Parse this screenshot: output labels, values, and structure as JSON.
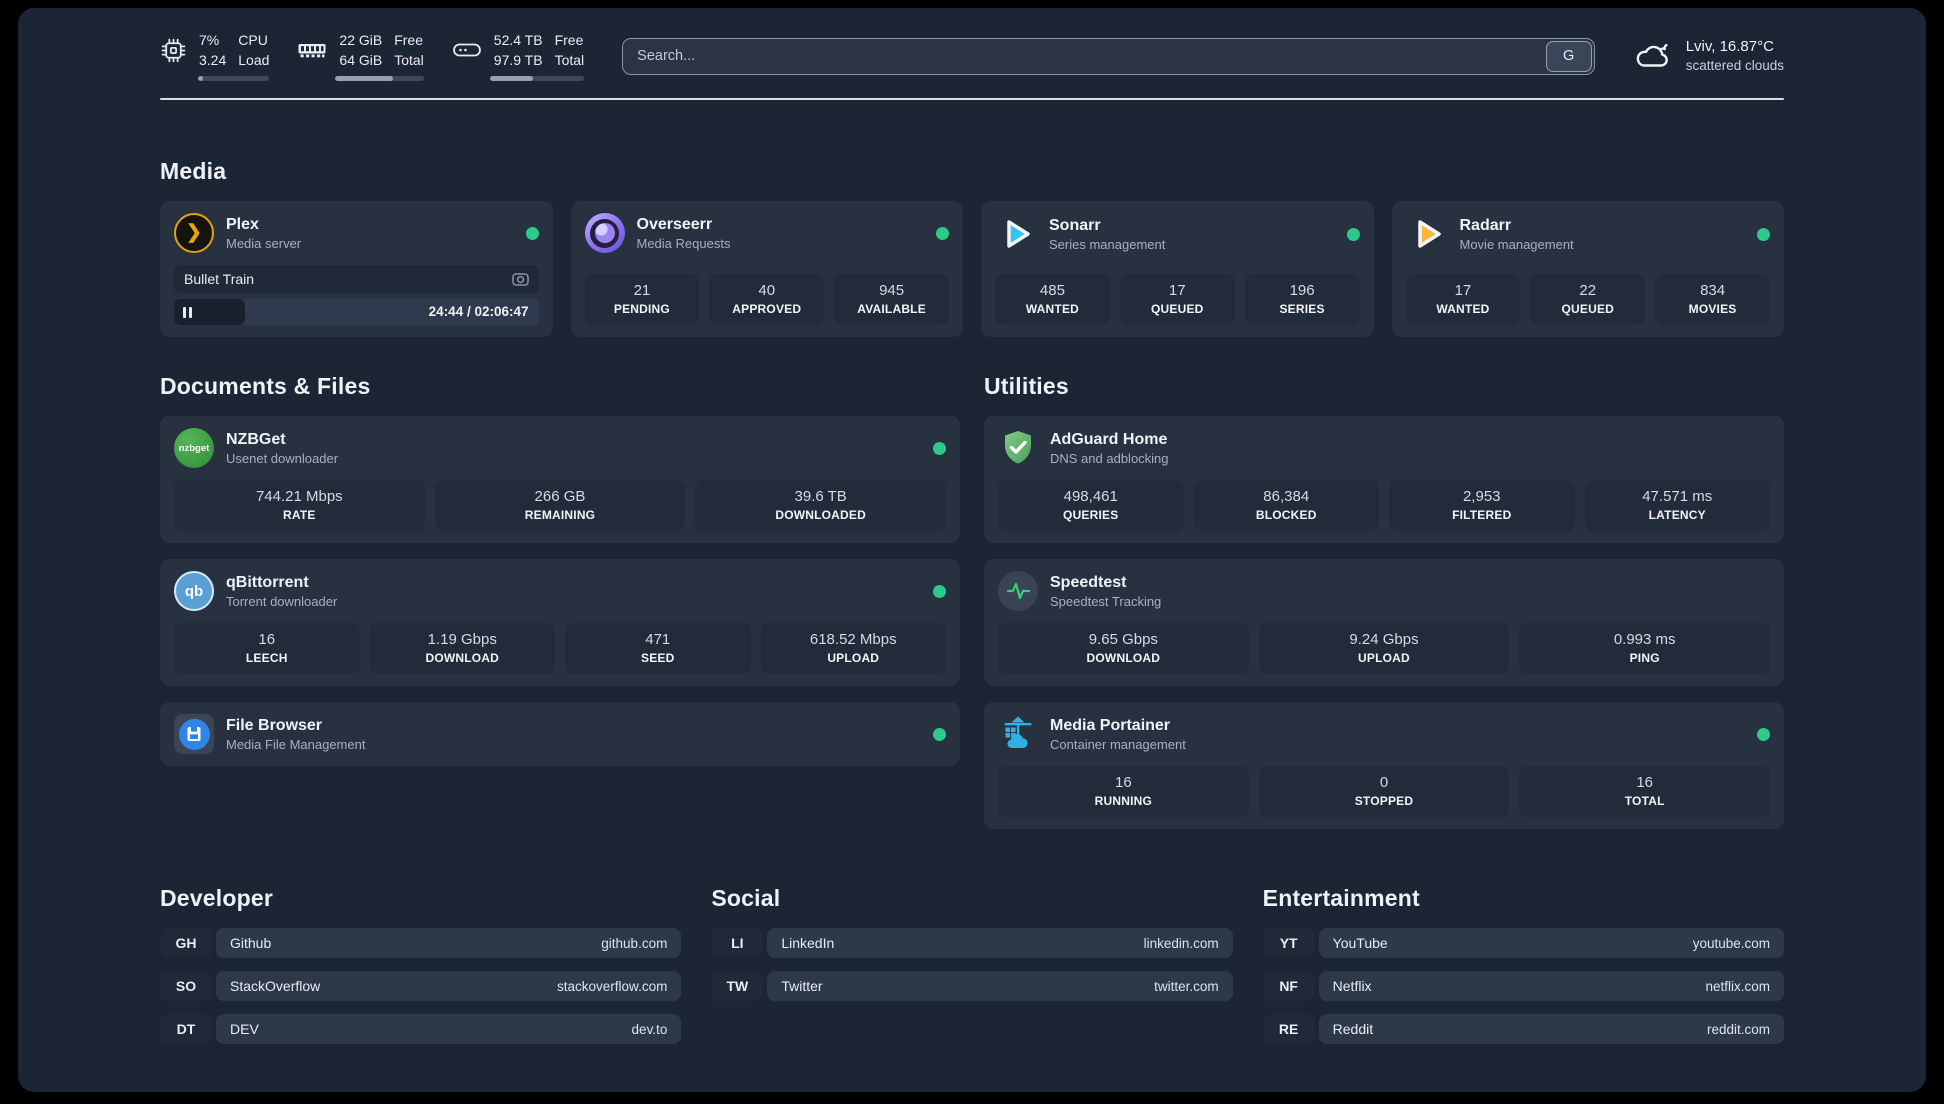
{
  "header": {
    "stats": [
      {
        "icon": "cpu-icon",
        "value_top": "7%",
        "value_bottom": "3.24",
        "label_top": "CPU",
        "label_bottom": "Load",
        "progress_pct": 7
      },
      {
        "icon": "ram-icon",
        "value_top": "22 GiB",
        "value_bottom": "64 GiB",
        "label_top": "Free",
        "label_bottom": "Total",
        "progress_pct": 65
      },
      {
        "icon": "disk-icon",
        "value_top": "52.4 TB",
        "value_bottom": "97.9 TB",
        "label_top": "Free",
        "label_bottom": "Total",
        "progress_pct": 46
      }
    ],
    "search": {
      "placeholder": "Search...",
      "button_label": "G"
    },
    "weather": {
      "location": "Lviv, 16.87°C",
      "condition": "scattered clouds"
    }
  },
  "icons": {
    "plex_glyph": "❯",
    "qbittorrent_text": "qb",
    "nzbget_text": "nzbget"
  },
  "sections": {
    "media": {
      "title": "Media",
      "cards": [
        {
          "name": "Plex",
          "subtitle": "Media server",
          "icon": "plex-icon",
          "online": true,
          "player": {
            "track_title": "Bullet Train",
            "time": "24:44 / 02:06:47",
            "progress_pct": 19.5
          }
        },
        {
          "name": "Overseerr",
          "subtitle": "Media Requests",
          "icon": "overseerr-icon",
          "online": true,
          "stats": [
            {
              "value": "21",
              "label": "PENDING"
            },
            {
              "value": "40",
              "label": "APPROVED"
            },
            {
              "value": "945",
              "label": "AVAILABLE"
            }
          ]
        },
        {
          "name": "Sonarr",
          "subtitle": "Series management",
          "icon": "sonarr-icon",
          "online": true,
          "stats": [
            {
              "value": "485",
              "label": "WANTED"
            },
            {
              "value": "17",
              "label": "QUEUED"
            },
            {
              "value": "196",
              "label": "SERIES"
            }
          ]
        },
        {
          "name": "Radarr",
          "subtitle": "Movie management",
          "icon": "radarr-icon",
          "online": true,
          "stats": [
            {
              "value": "17",
              "label": "WANTED"
            },
            {
              "value": "22",
              "label": "QUEUED"
            },
            {
              "value": "834",
              "label": "MOVIES"
            }
          ]
        }
      ]
    },
    "documents": {
      "title": "Documents & Files",
      "cards": [
        {
          "name": "NZBGet",
          "subtitle": "Usenet downloader",
          "icon": "nzbget-icon",
          "online": true,
          "stats": [
            {
              "value": "744.21 Mbps",
              "label": "RATE"
            },
            {
              "value": "266 GB",
              "label": "REMAINING"
            },
            {
              "value": "39.6 TB",
              "label": "DOWNLOADED"
            }
          ]
        },
        {
          "name": "qBittorrent",
          "subtitle": "Torrent downloader",
          "icon": "qbittorrent-icon",
          "online": true,
          "stats": [
            {
              "value": "16",
              "label": "LEECH"
            },
            {
              "value": "1.19 Gbps",
              "label": "DOWNLOAD"
            },
            {
              "value": "471",
              "label": "SEED"
            },
            {
              "value": "618.52 Mbps",
              "label": "UPLOAD"
            }
          ]
        },
        {
          "name": "File Browser",
          "subtitle": "Media File Management",
          "icon": "filebrowser-icon",
          "online": true,
          "stats": []
        }
      ]
    },
    "utilities": {
      "title": "Utilities",
      "cards": [
        {
          "name": "AdGuard Home",
          "subtitle": "DNS and adblocking",
          "icon": "adguard-icon",
          "online": true,
          "stats": [
            {
              "value": "498,461",
              "label": "QUERIES"
            },
            {
              "value": "86,384",
              "label": "BLOCKED"
            },
            {
              "value": "2,953",
              "label": "FILTERED"
            },
            {
              "value": "47.571 ms",
              "label": "LATENCY"
            }
          ]
        },
        {
          "name": "Speedtest",
          "subtitle": "Speedtest Tracking",
          "icon": "speedtest-icon",
          "online": true,
          "stats": [
            {
              "value": "9.65 Gbps",
              "label": "DOWNLOAD"
            },
            {
              "value": "9.24 Gbps",
              "label": "UPLOAD"
            },
            {
              "value": "0.993 ms",
              "label": "PING"
            }
          ]
        },
        {
          "name": "Media Portainer",
          "subtitle": "Container management",
          "icon": "portainer-icon",
          "online": true,
          "stats": [
            {
              "value": "16",
              "label": "RUNNING"
            },
            {
              "value": "0",
              "label": "STOPPED"
            },
            {
              "value": "16",
              "label": "TOTAL"
            }
          ]
        }
      ]
    },
    "links": [
      {
        "title": "Developer",
        "items": [
          {
            "tag": "GH",
            "name": "Github",
            "url": "github.com"
          },
          {
            "tag": "SO",
            "name": "StackOverflow",
            "url": "stackoverflow.com"
          },
          {
            "tag": "DT",
            "name": "DEV",
            "url": "dev.to"
          }
        ]
      },
      {
        "title": "Social",
        "items": [
          {
            "tag": "LI",
            "name": "LinkedIn",
            "url": "linkedin.com"
          },
          {
            "tag": "TW",
            "name": "Twitter",
            "url": "twitter.com"
          }
        ]
      },
      {
        "title": "Entertainment",
        "items": [
          {
            "tag": "YT",
            "name": "YouTube",
            "url": "youtube.com"
          },
          {
            "tag": "NF",
            "name": "Netflix",
            "url": "netflix.com"
          },
          {
            "tag": "RE",
            "name": "Reddit",
            "url": "reddit.com"
          }
        ]
      }
    ]
  },
  "colors": {
    "panel_bg": "#1c2534",
    "card_bg": "#273140",
    "tile_bg": "#212b3a",
    "online_dot": "#2bc98a",
    "plex_amber": "#e8a00c",
    "sonarr_cyan": "#35c5f4",
    "radarr_amber": "#ffb53c",
    "adguard_green": "#67b279",
    "portainer_blue": "#2fb1e3",
    "speedtest_green": "#35d07f"
  }
}
